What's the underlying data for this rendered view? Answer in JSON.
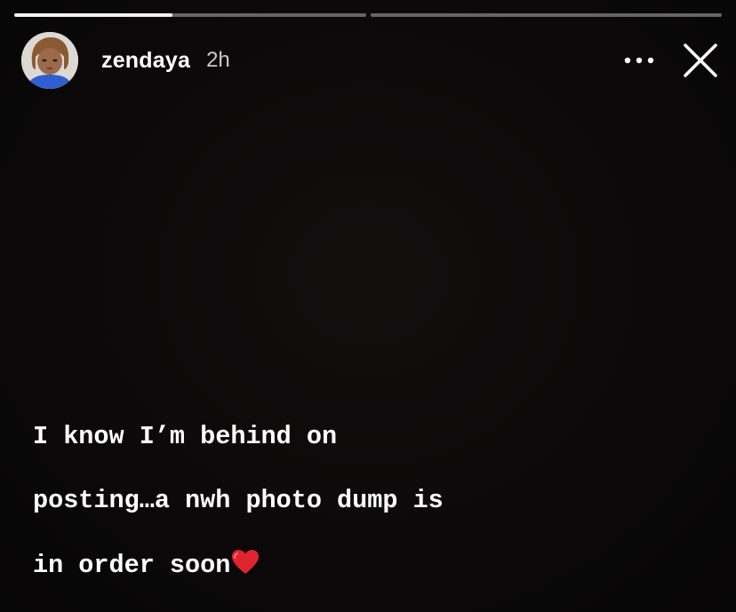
{
  "story": {
    "progress": [
      {
        "segment": 1,
        "fill": 0.45
      },
      {
        "segment": 2,
        "fill": 0.0
      }
    ],
    "header": {
      "username": "zendaya",
      "timestamp": "2h",
      "avatar_icon": "profile-photo",
      "more_icon": "more-horizontal-icon",
      "close_icon": "close-icon"
    },
    "caption": {
      "line1": "I know I’m behind on",
      "line2": "posting…a nwh photo dump is",
      "line3": "in order soon",
      "emoji": "heart-icon"
    },
    "colors": {
      "background": "#0a0808",
      "progress_track": "#7a7a7a",
      "progress_fill": "#f2f2f2",
      "text": "#ffffff",
      "heart": "#e0242f"
    }
  }
}
